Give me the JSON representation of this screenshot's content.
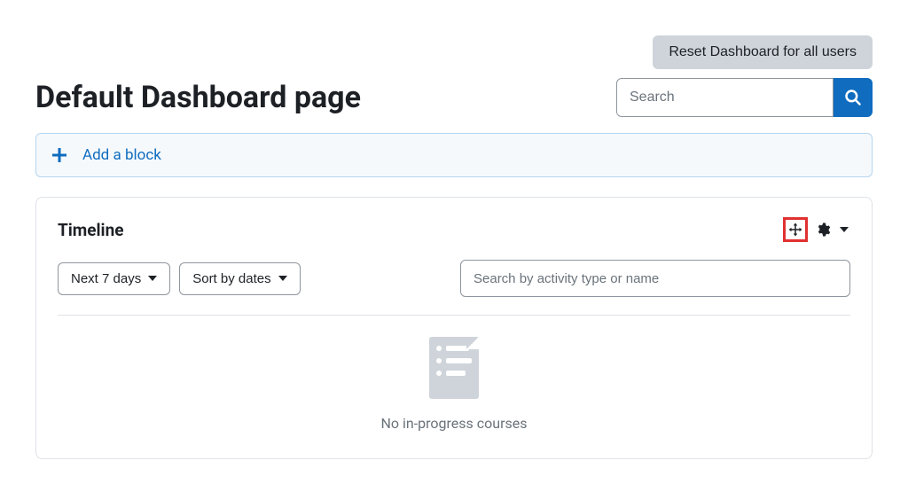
{
  "header": {
    "reset_label": "Reset Dashboard for all users",
    "title": "Default Dashboard page",
    "search_placeholder": "Search"
  },
  "add_block": {
    "label": "Add a block"
  },
  "timeline": {
    "title": "Timeline",
    "filter_label": "Next 7 days",
    "sort_label": "Sort by dates",
    "search_placeholder": "Search by activity type or name",
    "empty_text": "No in-progress courses"
  }
}
